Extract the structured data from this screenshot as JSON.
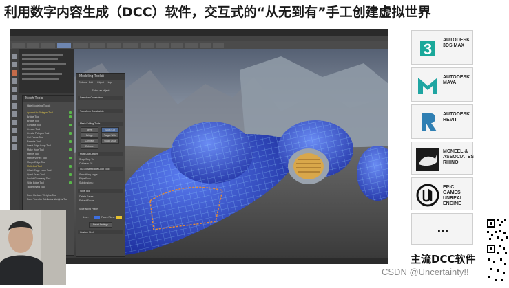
{
  "headline": "利用数字内容生成（DCC）软件，交互式的“从无到有”手工创建虚拟世界",
  "app": {
    "mesh_tools_panel": {
      "title": "Mesh Tools",
      "items": [
        "Hide Modeling Toolkit",
        "Append to Polygon Tool",
        "Bridge Tool",
        "Bridge Tool",
        "Connect Tool",
        "Crease Tool",
        "Create Polygon Tool",
        "Cut Faces Tool",
        "Extrude Tool",
        "Insert Edge Loop Tool",
        "Make Hole Tool",
        "Merge Tool",
        "Merge Vertex Tool",
        "Merge Edge Tool",
        "Multi-Cut Tool",
        "Offset Edge Loop Tool",
        "Quad Draw Tool",
        "Sculpt Geometry Tool",
        "Slide Edge Tool",
        "Target Weld Tool",
        "Paint Reduce Weights Tool",
        "Paint Transfer Attributes Weights Tool"
      ]
    },
    "modeling_toolkit": {
      "title": "Modeling Toolkit",
      "menu": [
        "Options",
        "Edit",
        "Object",
        "Help"
      ],
      "select_label": "Select an object",
      "selection_constraints": "Selection Constraints",
      "transform_constraints": "Transform Constraints",
      "sections": [
        "Mesh Editing Tools",
        "Multi-Cut Options",
        "Cut / Insert Edge Loop Tool",
        "Slice Tool",
        "Custom Shelf"
      ],
      "tool_buttons": [
        "Bevel",
        "Multi-Cut",
        "Bridge",
        "Target Weld",
        "Connect",
        "Quad Draw",
        "Extrude"
      ],
      "options": [
        "Snap Step %:",
        "Collinear Fill",
        "Smoothing Angle:",
        "Edge Flow",
        "Subdivisions:",
        "Delete Faces",
        "Extract Faces",
        "Slice along Plane:"
      ],
      "bottom_rows": [
        "Line:",
        "Faces Plane:",
        "Reset Settings"
      ]
    }
  },
  "sidebar": {
    "products": [
      {
        "name": "AUTODESK\n3DS MAX",
        "icon": "3dsmax-icon",
        "color": "#1aa89a"
      },
      {
        "name": "AUTODESK\nMAYA",
        "icon": "maya-icon",
        "color": "#1fa5a2"
      },
      {
        "name": "AUTODESK\nREVIT",
        "icon": "revit-icon",
        "color": "#2f7fb3"
      },
      {
        "name": "MCNEEL &\nASSOCIATES\nRHINO",
        "icon": "rhino-icon",
        "color": "#111111"
      },
      {
        "name": "EPIC GAMES'\nUNREAL\nENGINE",
        "icon": "unreal-icon",
        "color": "#111111"
      }
    ],
    "more_label": "...",
    "caption": "主流DCC软件"
  },
  "watermark": "CSDN @Uncertainty!!"
}
